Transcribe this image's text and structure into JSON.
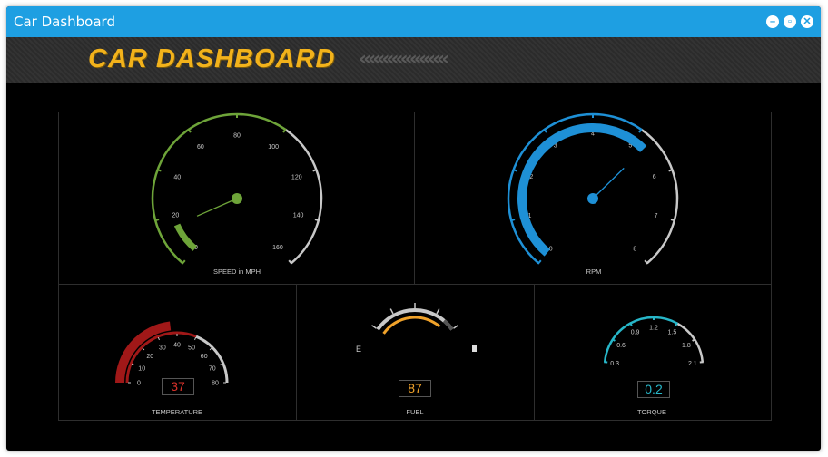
{
  "window": {
    "title": "Car Dashboard"
  },
  "banner": {
    "logo_text": "CAR DASHBOARD",
    "chevrons": "‹‹‹‹‹‹‹‹‹‹‹‹‹‹‹‹‹‹‹"
  },
  "colors": {
    "titlebar": "#1e9fe2",
    "speed": "#6ea439",
    "rpm": "#1e90d6",
    "temperature": "#a01818",
    "fuel": "#f0a22a",
    "torque": "#27b6c8",
    "track": "#c8c8c8"
  },
  "gauges": {
    "speed": {
      "caption": "SPEED in MPH",
      "ticks": [
        "0",
        "20",
        "40",
        "60",
        "80",
        "100",
        "120",
        "140",
        "160"
      ],
      "min": 0,
      "max": 160,
      "value": 15,
      "range_end": 100
    },
    "rpm": {
      "caption": "RPM",
      "ticks": [
        "0",
        "1",
        "2",
        "3",
        "4",
        "5",
        "6",
        "7",
        "8"
      ],
      "min": 0,
      "max": 8,
      "value": 5.3,
      "range_end": 5
    },
    "temperature": {
      "caption": "TEMPERATURE",
      "ticks": [
        "0",
        "10",
        "20",
        "30",
        "40",
        "50",
        "60",
        "70",
        "80"
      ],
      "min": 0,
      "max": 80,
      "value": 37,
      "value_text": "37",
      "range_end": 50
    },
    "fuel": {
      "caption": "FUEL",
      "empty_label": "E",
      "value": 87,
      "value_text": "87",
      "icon": "fuel-pump-icon"
    },
    "torque": {
      "caption": "TORQUE",
      "ticks": [
        "0.3",
        "0.6",
        "0.9",
        "1.2",
        "1.5",
        "1.8",
        "2.1"
      ],
      "min": 0.3,
      "max": 2.1,
      "value": 0.2,
      "value_text": "0.2",
      "range_end": 1.5
    }
  }
}
